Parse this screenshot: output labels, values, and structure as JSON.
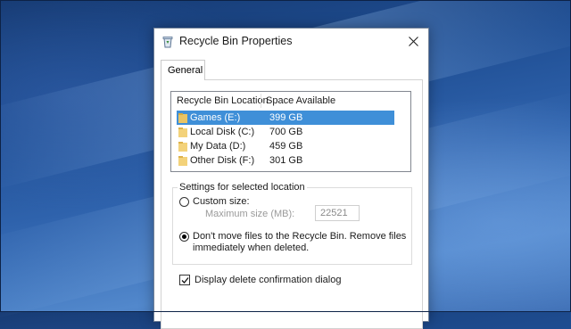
{
  "window": {
    "title": "Recycle Bin Properties",
    "icon": "recycle-bin-icon",
    "close_icon": "close-icon"
  },
  "tabs": [
    {
      "label": "General",
      "active": true
    }
  ],
  "location_list": {
    "columns": [
      "Recycle Bin Location",
      "Space Available"
    ],
    "rows": [
      {
        "name": "Games (E:)",
        "space": "399 GB",
        "selected": true,
        "icon": "folder-icon"
      },
      {
        "name": "Local Disk (C:)",
        "space": "700 GB",
        "selected": false,
        "icon": "folder-icon"
      },
      {
        "name": "My Data (D:)",
        "space": "459 GB",
        "selected": false,
        "icon": "folder-icon"
      },
      {
        "name": "Other Disk (F:)",
        "space": "301 GB",
        "selected": false,
        "icon": "folder-icon"
      }
    ]
  },
  "settings": {
    "group_label": "Settings for selected location",
    "custom_size_label": "Custom size:",
    "custom_size_checked": false,
    "max_size_label": "Maximum size (MB):",
    "max_size_value": "22521",
    "dont_move_label_line1": "Don't move files to the Recycle Bin. Remove files",
    "dont_move_label_line2": "immediately when deleted.",
    "dont_move_checked": true
  },
  "confirm": {
    "label": "Display delete confirmation dialog",
    "checked": true
  },
  "colors": {
    "selection": "#3f8fd8",
    "desktop": "#2f63ad"
  }
}
